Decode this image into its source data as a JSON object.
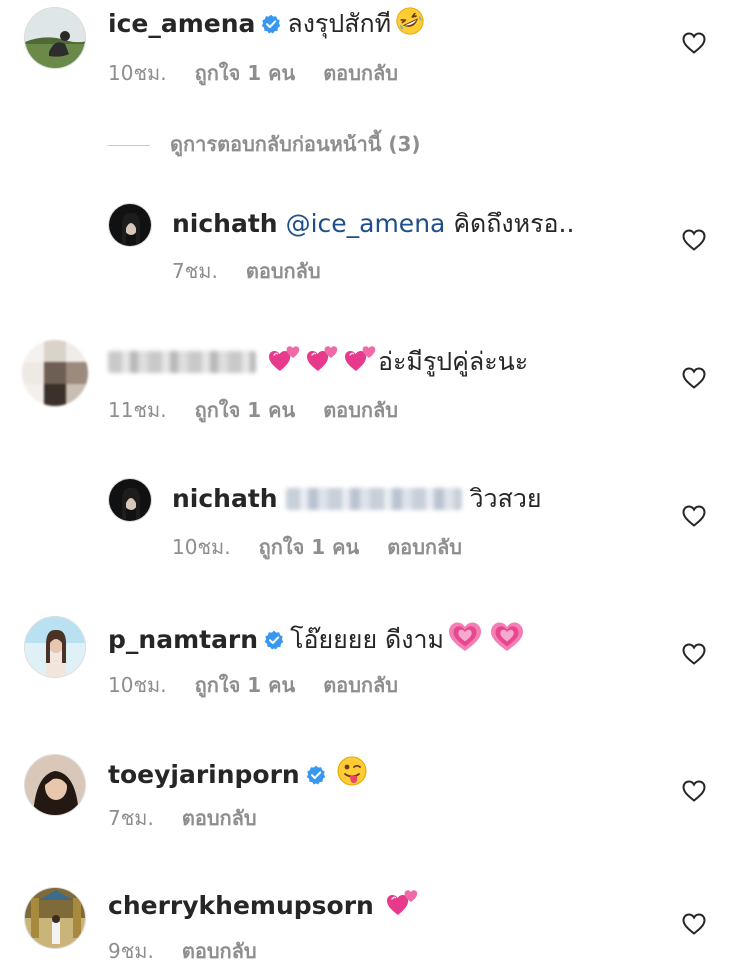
{
  "colors": {
    "mention": "#1f4f8a",
    "meta_gray": "#8e8e8e",
    "verified_blue": "#3897f0"
  },
  "comments": [
    {
      "username": "ice_amena",
      "verified": true,
      "text": "ลงรุปสักที",
      "emoji": "rolling-on-floor-laughing",
      "time": "10ชม.",
      "likes": "ถูกใจ 1 คน",
      "reply": "ตอบกลับ"
    },
    {
      "view_previous": "ดูการตอบกลับก่อนหน้านี้ (3)"
    },
    {
      "username": "nichath",
      "mention": "@ice_amena",
      "text": "คิดถึงหรอ..",
      "time": "7ชม.",
      "reply": "ตอบกลับ"
    },
    {
      "text": "อ่ะมีรูปคู่ล่ะนะ",
      "emoji": "two-hearts x3",
      "time": "11ชม.",
      "likes": "ถูกใจ 1 คน",
      "reply": "ตอบกลับ"
    },
    {
      "username": "nichath",
      "text": "วิวสวย",
      "time": "10ชม.",
      "likes": "ถูกใจ 1 คน",
      "reply": "ตอบกลับ"
    },
    {
      "username": "p_namtarn",
      "verified": true,
      "text": "โอ๊ยยยย ดีงาม",
      "emoji": "growing-heart x2",
      "time": "10ชม.",
      "likes": "ถูกใจ 1 คน",
      "reply": "ตอบกลับ"
    },
    {
      "username": "toeyjarinporn",
      "verified": true,
      "emoji": "winking-face-with-tongue",
      "time": "7ชม.",
      "reply": "ตอบกลับ"
    },
    {
      "username": "cherrykhemupsorn",
      "emoji": "two-hearts",
      "time": "9ชม.",
      "reply": "ตอบกลับ"
    }
  ]
}
